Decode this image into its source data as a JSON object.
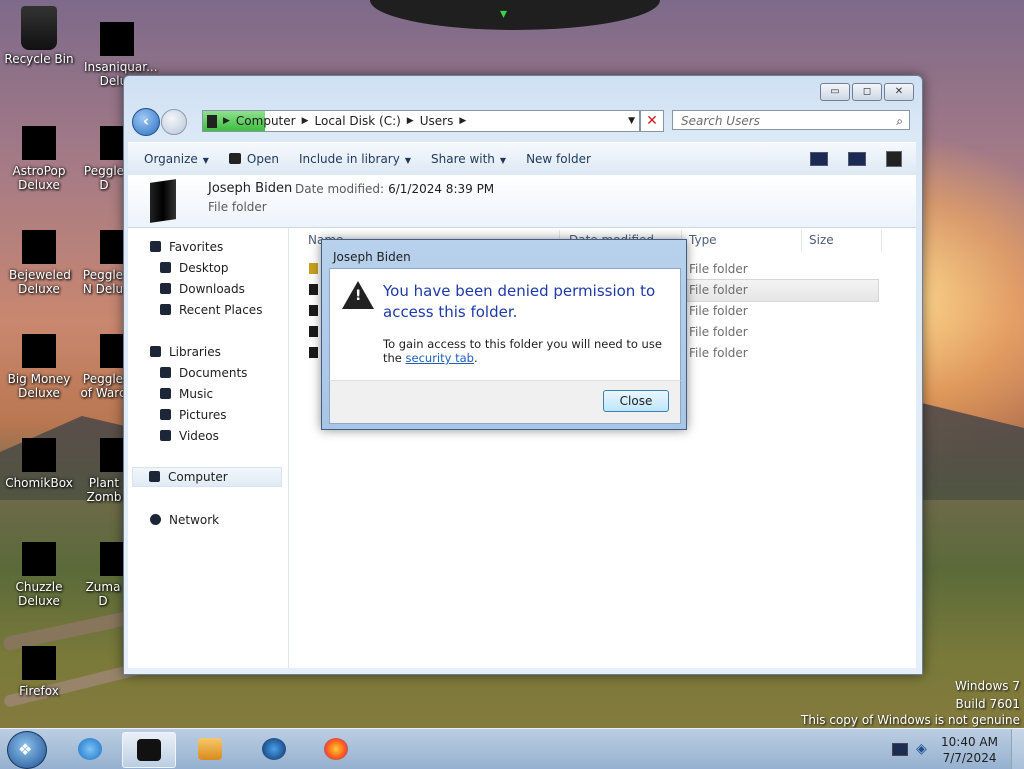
{
  "desktop": {
    "icons": [
      {
        "label": "Recycle Bin"
      },
      {
        "label": "Insaniquar... Delux"
      },
      {
        "label": "AstroPop Deluxe"
      },
      {
        "label": "Peggle D"
      },
      {
        "label": "Bejeweled Deluxe"
      },
      {
        "label": "Peggle N Delu"
      },
      {
        "label": "Big Money Deluxe"
      },
      {
        "label": "Peggle of Warc"
      },
      {
        "label": "ChomikBox"
      },
      {
        "label": "Plant Zomb"
      },
      {
        "label": "Chuzzle Deluxe"
      },
      {
        "label": "Zuma D"
      },
      {
        "label": "Firefox"
      }
    ],
    "watermark": [
      "Windows 7",
      "Build 7601",
      "This copy of Windows is not genuine"
    ]
  },
  "explorer": {
    "address": {
      "segments": [
        "Computer",
        "Local Disk (C:)",
        "Users"
      ]
    },
    "search_placeholder": "Search Users",
    "window_buttons": {
      "minimize": "▭",
      "maximize": "◻",
      "close": "✕"
    },
    "toolbar": {
      "organize": "Organize",
      "open": "Open",
      "include": "Include in library",
      "share": "Share with",
      "new_folder": "New folder"
    },
    "details": {
      "name": "Joseph Biden",
      "date_label": "Date modified:",
      "date_value": "6/1/2024 8:39 PM",
      "type": "File folder"
    },
    "nav": {
      "favorites": "Favorites",
      "desktop": "Desktop",
      "downloads": "Downloads",
      "recent": "Recent Places",
      "libraries": "Libraries",
      "documents": "Documents",
      "music": "Music",
      "pictures": "Pictures",
      "videos": "Videos",
      "computer": "Computer",
      "network": "Network"
    },
    "columns": {
      "name": "Name",
      "date": "Date modified",
      "type": "Type",
      "size": "Size"
    },
    "rows": [
      {
        "type": "File folder"
      },
      {
        "type": "File folder"
      },
      {
        "type": "File folder"
      },
      {
        "type": "File folder"
      },
      {
        "type": "File folder"
      }
    ]
  },
  "dialog": {
    "title": "Joseph Biden",
    "heading": "You have been denied permission to access this folder.",
    "message": "To gain access to this folder you will need to use the",
    "link": "security tab",
    "close": "Close"
  },
  "taskbar": {
    "time": "10:40 AM",
    "date": "7/7/2024"
  }
}
